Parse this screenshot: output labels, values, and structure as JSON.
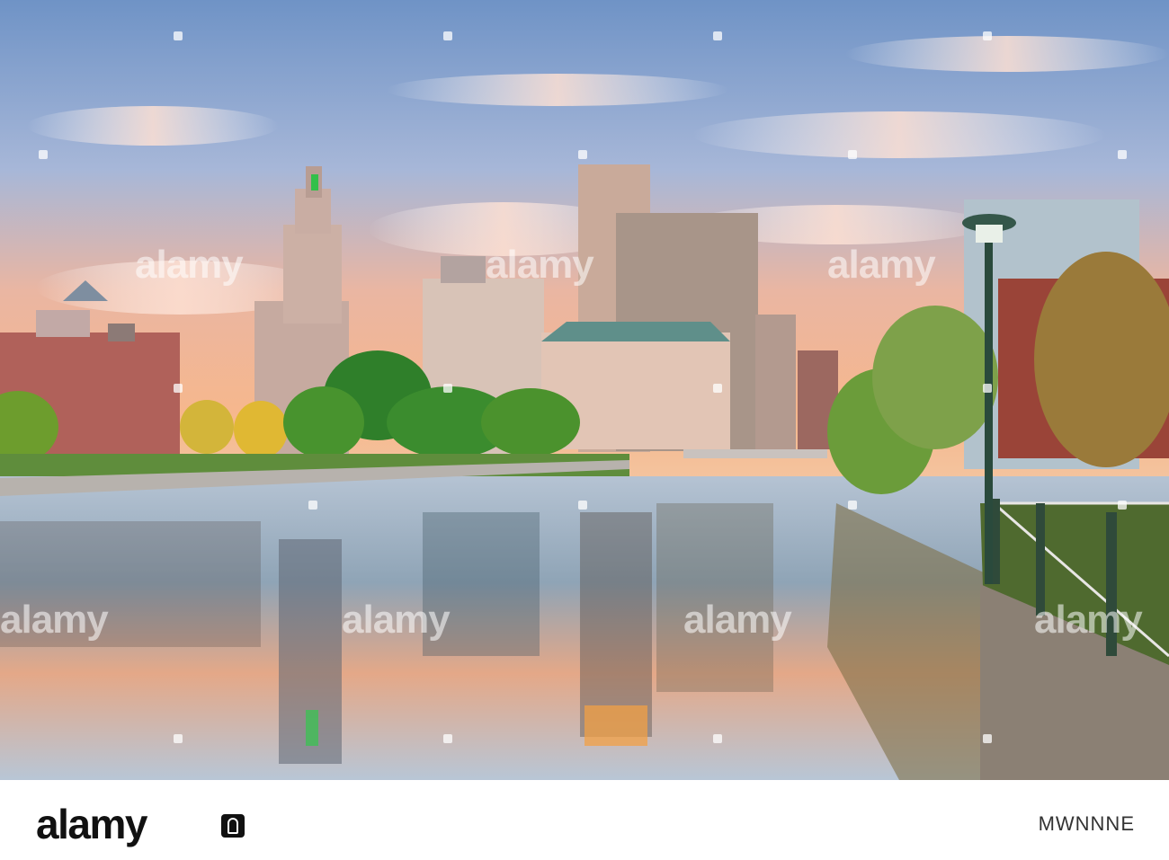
{
  "watermark": {
    "text": "alamy",
    "color": "#ffffff"
  },
  "footer": {
    "logo_text": "alamy",
    "image_id_label": "",
    "image_id": "MWNNNE"
  },
  "scene": {
    "subject": "city skyline at dusk reflected in river",
    "colors": {
      "sky_top": "#7c9cc9",
      "sky_glow": "#f4b28a",
      "water": "#8fa6b7",
      "foliage": "#3f8a2a"
    }
  }
}
